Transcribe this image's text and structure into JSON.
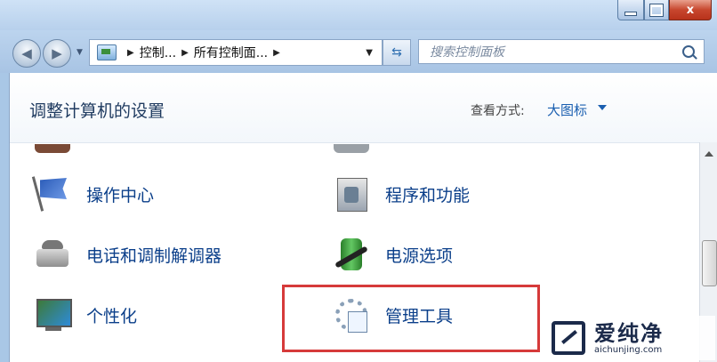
{
  "window": {
    "min_icon": "minimize-icon",
    "max_icon": "maximize-icon",
    "close_label": "x"
  },
  "address_bar": {
    "crumbs": [
      "控制...",
      "所有控制面..."
    ],
    "search_placeholder": "搜索控制面板"
  },
  "header": {
    "title": "调整计算机的设置",
    "view_label": "查看方式:",
    "view_value": "大图标"
  },
  "items": [
    {
      "label": "操作中心",
      "icon": "flag-icon"
    },
    {
      "label": "程序和功能",
      "icon": "programs-icon"
    },
    {
      "label": "电话和调制解调器",
      "icon": "phone-icon"
    },
    {
      "label": "电源选项",
      "icon": "battery-icon"
    },
    {
      "label": "个性化",
      "icon": "monitor-icon"
    },
    {
      "label": "管理工具",
      "icon": "tools-icon"
    }
  ],
  "watermark": {
    "main": "爱纯净",
    "sub": "aichunjing.com"
  },
  "colors": {
    "highlight": "#d63a3a",
    "link": "#0b3f8a"
  }
}
